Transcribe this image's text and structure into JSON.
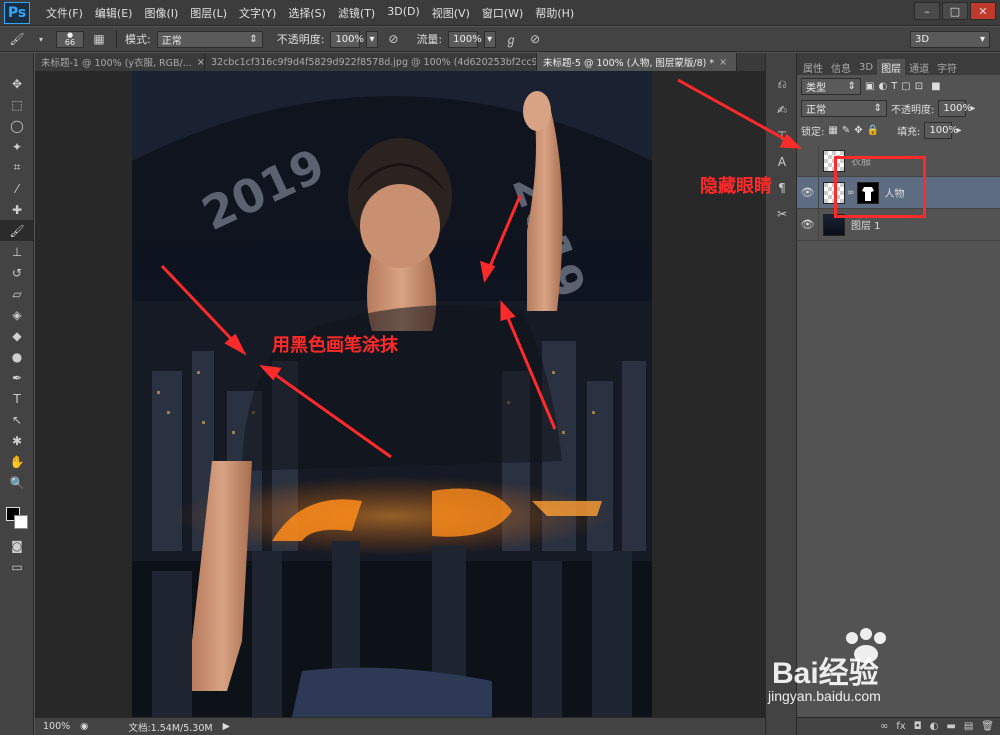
{
  "app": {
    "logo": "Ps"
  },
  "menu": [
    "文件(F)",
    "编辑(E)",
    "图像(I)",
    "图层(L)",
    "文字(Y)",
    "选择(S)",
    "滤镜(T)",
    "3D(D)",
    "视图(V)",
    "窗口(W)",
    "帮助(H)"
  ],
  "window_controls": [
    "–",
    "□",
    "✕"
  ],
  "options": {
    "brush_size": "66",
    "mode_label": "模式:",
    "mode_value": "正常",
    "opacity_label": "不透明度:",
    "opacity_value": "100%",
    "flow_label": "流量:",
    "flow_value": "100%",
    "workspace": "3D"
  },
  "tabs": [
    {
      "label": "未标题-1 @ 100% (y衣服, RGB/..."
    },
    {
      "label": "32cbc1cf316c9f9d4f5829d922f8578d.jpg @ 100% (4d620253bf2cc9..."
    },
    {
      "label": "未标题-5 @ 100% (人物, 图层蒙版/8) *"
    }
  ],
  "status": {
    "zoom": "100%",
    "doc": "文档:1.54M/5.30M"
  },
  "annotations": {
    "brush_note": "用黑色画笔涂抹",
    "hide_eye_note": "隐藏眼睛"
  },
  "panel": {
    "tabs": [
      "属性",
      "信息",
      "3D",
      "图层",
      "通道",
      "字符"
    ],
    "kind_filter": "类型",
    "blend_mode": "正常",
    "opacity_label": "不透明度:",
    "opacity_value": "100%",
    "lock_label": "锁定:",
    "fill_label": "填充:",
    "fill_value": "100%",
    "layers": [
      {
        "name": "衣服",
        "visible": false
      },
      {
        "name": "人物",
        "visible": true
      },
      {
        "name": "图层 1",
        "visible": true
      }
    ]
  },
  "watermark": {
    "brand": "Bai经验",
    "url": "jingyan.baidu.com"
  },
  "artwork": {
    "year": "2019"
  }
}
